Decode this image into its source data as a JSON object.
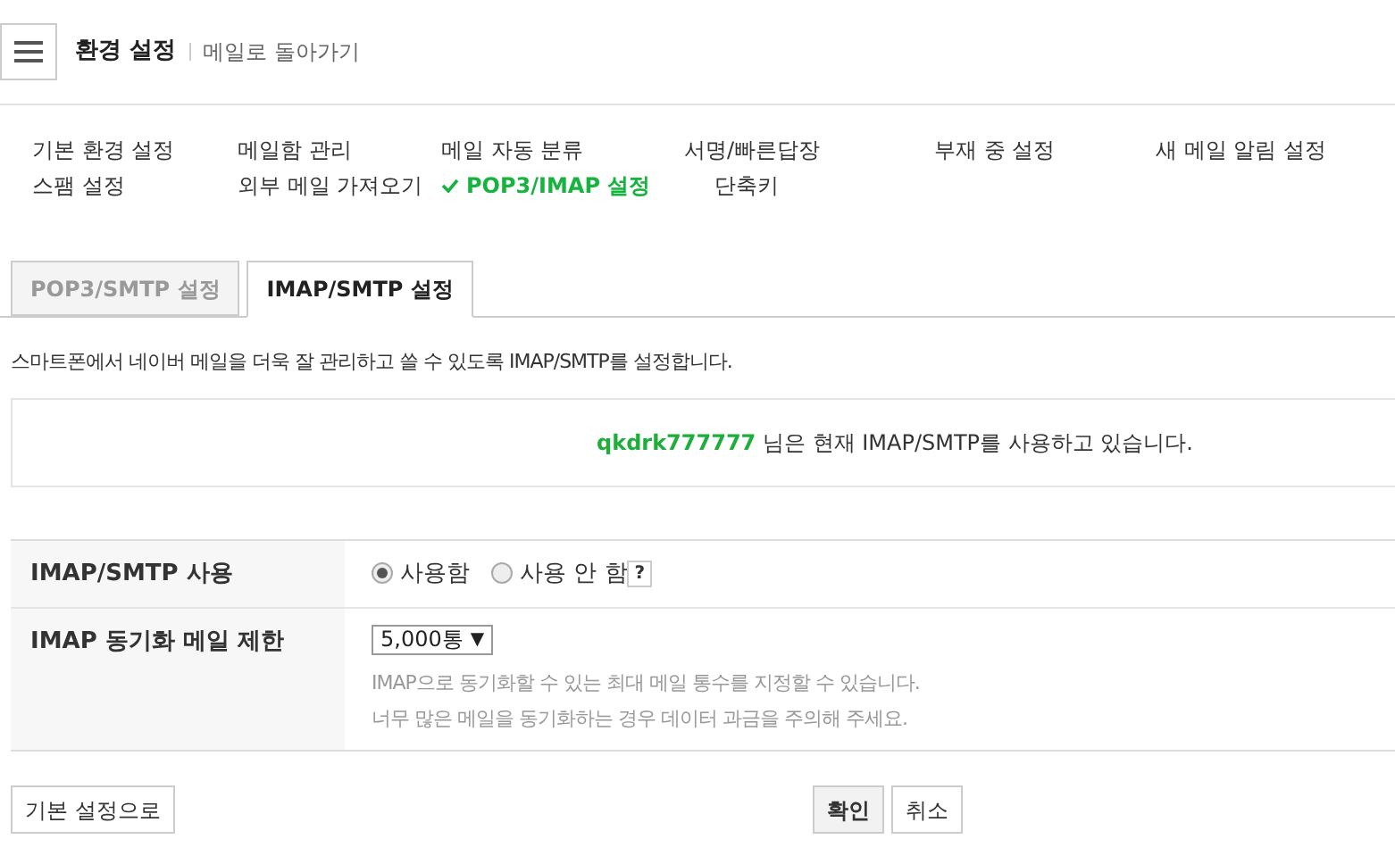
{
  "header": {
    "title": "환경 설정",
    "back_link": "메일로 돌아가기"
  },
  "nav": [
    {
      "label": "기본 환경 설정",
      "selected": false
    },
    {
      "label": "메일함 관리",
      "selected": false
    },
    {
      "label": "메일 자동 분류",
      "selected": false
    },
    {
      "label": "서명/빠른답장",
      "selected": false
    },
    {
      "label": "부재 중 설정",
      "selected": false
    },
    {
      "label": "새 메일 알림 설정",
      "selected": false
    },
    {
      "label": "스팸 설정",
      "selected": false
    },
    {
      "label": "외부 메일 가져오기",
      "selected": false
    },
    {
      "label": "POP3/IMAP 설정",
      "selected": true
    },
    {
      "label": "단축키",
      "selected": false
    }
  ],
  "tabs": [
    {
      "label": "POP3/SMTP 설정",
      "selected": false
    },
    {
      "label": "IMAP/SMTP 설정",
      "selected": true
    }
  ],
  "description": "스마트폰에서 네이버 메일을 더욱 잘 관리하고 쓸 수 있도록 IMAP/SMTP를 설정합니다.",
  "status": {
    "user": "qkdrk777777",
    "message": "님은 현재 IMAP/SMTP를 사용하고 있습니다."
  },
  "settings": [
    {
      "kind": "radio",
      "label": "IMAP/SMTP 사용",
      "options": [
        {
          "label": "사용함",
          "selected": true
        },
        {
          "label": "사용 안 함",
          "selected": false
        }
      ],
      "help": "?"
    },
    {
      "kind": "select",
      "label": "IMAP 동기화 메일 제한",
      "value": "5,000통",
      "caret": "▼",
      "notes": [
        "IMAP으로 동기화할 수 있는 최대 메일 통수를 지정할 수 있습니다.",
        "너무 많은 메일을 동기화하는 경우 데이터 과금을 주의해 주세요."
      ]
    }
  ],
  "buttons": {
    "reset": "기본 설정으로",
    "confirm": "확인",
    "cancel": "취소"
  }
}
